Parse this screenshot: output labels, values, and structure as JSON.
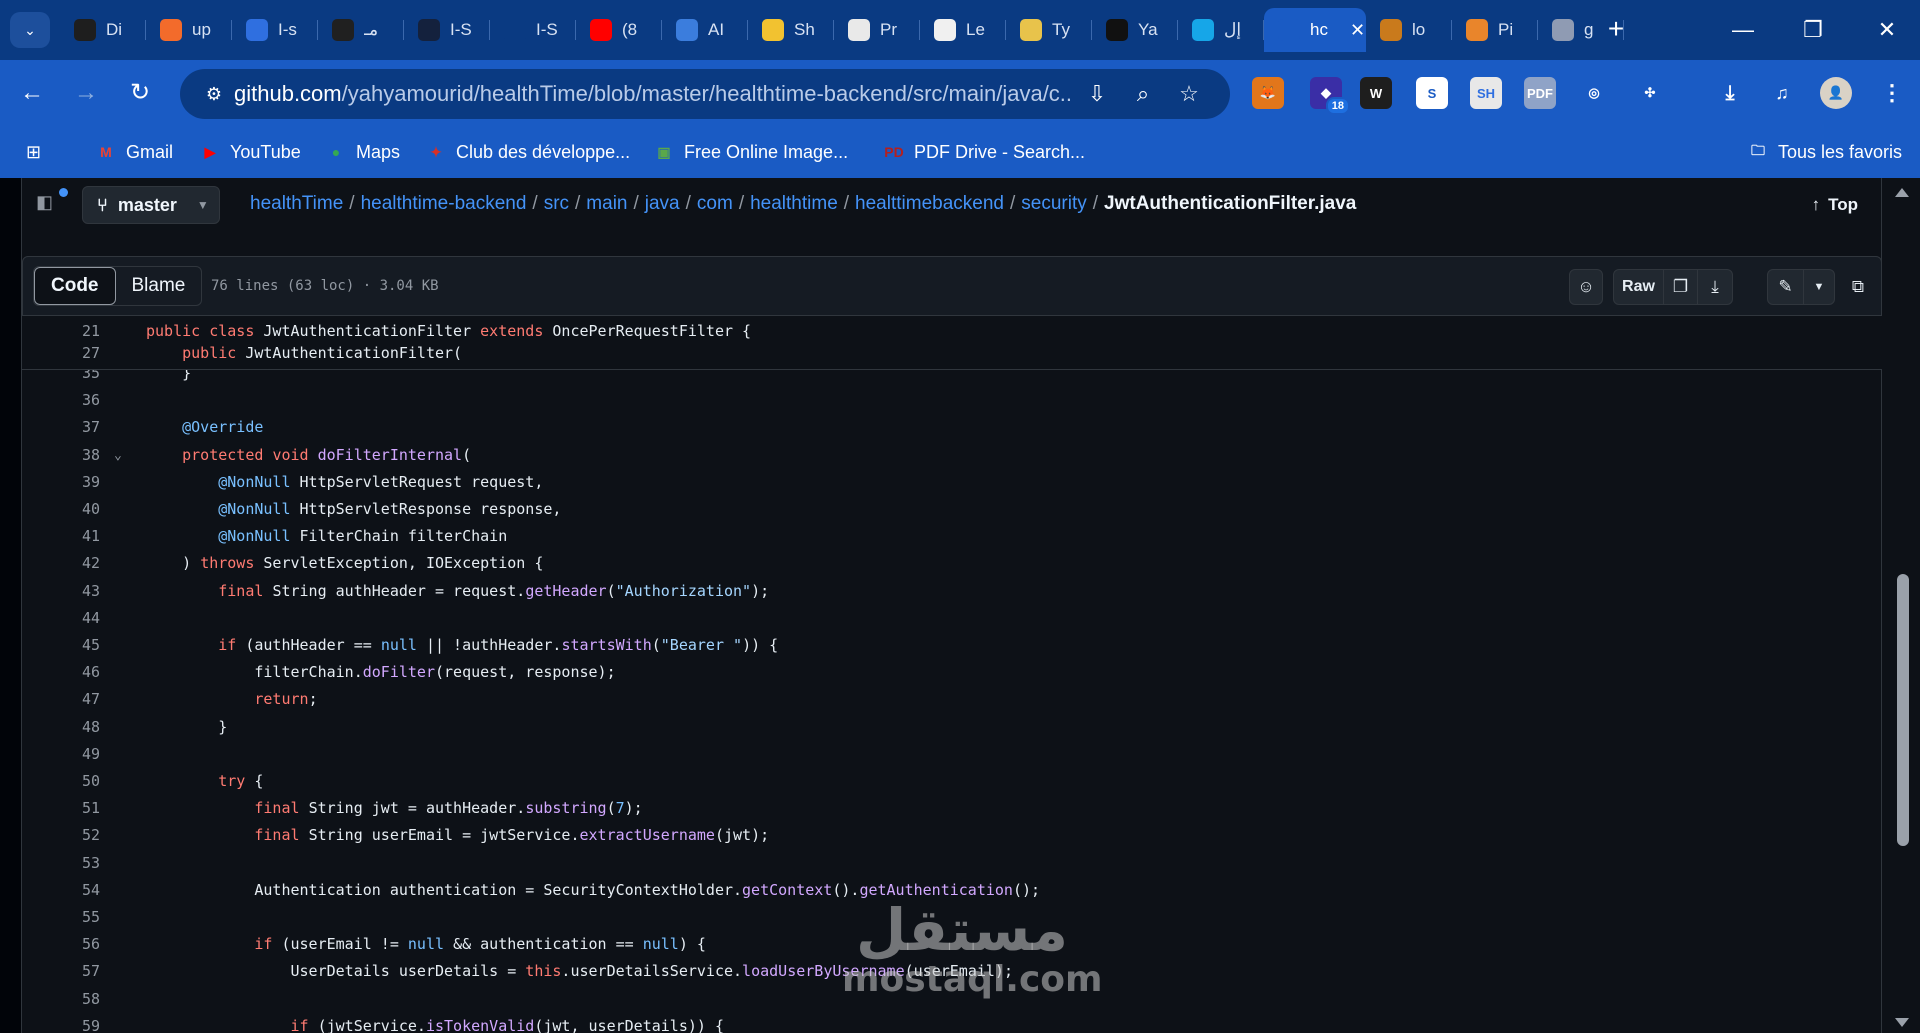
{
  "browser": {
    "tabs": [
      {
        "title": "Di",
        "icon": "wakatime-icon",
        "color": "#1e1e1e"
      },
      {
        "title": "up",
        "icon": "compass-icon",
        "color": "#f36b2b"
      },
      {
        "title": "I-s",
        "icon": "ide-icon",
        "color": "#2f6fe0"
      },
      {
        "title": "مـ",
        "icon": "openai-icon",
        "color": "#202020"
      },
      {
        "title": "I-S",
        "icon": "keyhole-icon",
        "color": "#14213d"
      },
      {
        "title": "I-S",
        "icon": "play-icon",
        "color": "#0a3a82"
      },
      {
        "title": "(8",
        "icon": "youtube-icon",
        "color": "#ff0000"
      },
      {
        "title": "AI",
        "icon": "iq-icon",
        "color": "#3b7ddd"
      },
      {
        "title": "Sh",
        "icon": "shield-icon",
        "color": "#f2c230"
      },
      {
        "title": "Pr",
        "icon": "document-icon",
        "color": "#e9e9e9"
      },
      {
        "title": "Le",
        "icon": "avatar-icon",
        "color": "#f0f0f0"
      },
      {
        "title": "Ty",
        "icon": "lock-icon",
        "color": "#e8c34b"
      },
      {
        "title": "Ya",
        "icon": "upwork-icon",
        "color": "#111111"
      },
      {
        "title": "إل",
        "icon": "circle-icon",
        "color": "#16a6e8"
      },
      {
        "title": "hc",
        "icon": "github-icon",
        "color": "#1a5bc4",
        "active": true
      },
      {
        "title": "lo",
        "icon": "mountain-icon",
        "color": "#c97a1c"
      },
      {
        "title": "Pi",
        "icon": "brush-icon",
        "color": "#e9852b"
      },
      {
        "title": "g",
        "icon": "globe-icon",
        "color": "#8f9bb3"
      }
    ],
    "active_close": "✕",
    "new_tab": "+",
    "url_host": "github.com",
    "url_path": "/yahyamourid/healthTime/blob/master/healthtime-backend/src/main/java/c...",
    "extension_badge": "18",
    "bookmarks": [
      {
        "label": "Gmail",
        "icon": "gmail-icon",
        "glyph": "M",
        "color": "#ea4335"
      },
      {
        "label": "YouTube",
        "icon": "youtube-icon",
        "glyph": "▶",
        "color": "#ff0000"
      },
      {
        "label": "Maps",
        "icon": "maps-pin-icon",
        "glyph": "●",
        "color": "#34a853"
      },
      {
        "label": "Club des développe...",
        "icon": "developpez-icon",
        "glyph": "✦",
        "color": "#d93025"
      },
      {
        "label": "Free Online Image...",
        "icon": "image-icon",
        "glyph": "▣",
        "color": "#5aa84a"
      },
      {
        "label": "PDF Drive - Search...",
        "icon": "pdf-drive-icon",
        "glyph": "PD",
        "color": "#b32020"
      }
    ],
    "all_bookmarks": "Tous les favoris"
  },
  "github": {
    "branch": "master",
    "breadcrumb": [
      "healthTime",
      "healthtime-backend",
      "src",
      "main",
      "java",
      "com",
      "healthtime",
      "healttimebackend",
      "security"
    ],
    "filename": "JwtAuthenticationFilter.java",
    "top_label": "Top",
    "tabs": {
      "code": "Code",
      "blame": "Blame"
    },
    "file_meta": "76 lines (63 loc) · 3.04 KB",
    "raw_label": "Raw"
  },
  "sticky_lines": [
    {
      "n": "21",
      "tokens": [
        [
          "k",
          "public "
        ],
        [
          "k",
          "class "
        ],
        [
          "t",
          "JwtAuthenticationFilter "
        ],
        [
          "k",
          "extends "
        ],
        [
          "t",
          "OncePerRequestFilter {"
        ]
      ]
    },
    {
      "n": "27",
      "tokens": [
        [
          "t",
          "    "
        ],
        [
          "k",
          "public "
        ],
        [
          "t",
          "JwtAuthenticationFilter("
        ]
      ]
    }
  ],
  "code_lines": [
    {
      "n": "35",
      "tokens": [
        [
          "t",
          "    }"
        ]
      ],
      "partial": true
    },
    {
      "n": "36",
      "tokens": []
    },
    {
      "n": "37",
      "tokens": [
        [
          "t",
          "    "
        ],
        [
          "m",
          "@Override"
        ]
      ]
    },
    {
      "n": "38",
      "fold": true,
      "tokens": [
        [
          "t",
          "    "
        ],
        [
          "k",
          "protected "
        ],
        [
          "k",
          "void "
        ],
        [
          "f",
          "doFilterInternal"
        ],
        [
          "t",
          "("
        ]
      ]
    },
    {
      "n": "39",
      "tokens": [
        [
          "t",
          "        "
        ],
        [
          "m",
          "@NonNull "
        ],
        [
          "t",
          "HttpServletRequest request,"
        ]
      ]
    },
    {
      "n": "40",
      "tokens": [
        [
          "t",
          "        "
        ],
        [
          "m",
          "@NonNull "
        ],
        [
          "t",
          "HttpServletResponse response,"
        ]
      ]
    },
    {
      "n": "41",
      "tokens": [
        [
          "t",
          "        "
        ],
        [
          "m",
          "@NonNull "
        ],
        [
          "t",
          "FilterChain filterChain"
        ]
      ]
    },
    {
      "n": "42",
      "tokens": [
        [
          "t",
          "    ) "
        ],
        [
          "k",
          "throws "
        ],
        [
          "t",
          "ServletException, IOException {"
        ]
      ]
    },
    {
      "n": "43",
      "tokens": [
        [
          "t",
          "        "
        ],
        [
          "k",
          "final "
        ],
        [
          "t",
          "String authHeader = request."
        ],
        [
          "f",
          "getHeader"
        ],
        [
          "t",
          "("
        ],
        [
          "s",
          "\"Authorization\""
        ],
        [
          "t",
          ");"
        ]
      ]
    },
    {
      "n": "44",
      "tokens": []
    },
    {
      "n": "45",
      "tokens": [
        [
          "t",
          "        "
        ],
        [
          "k",
          "if "
        ],
        [
          "t",
          "(authHeader == "
        ],
        [
          "m",
          "null "
        ],
        [
          "t",
          "|| !authHeader."
        ],
        [
          "f",
          "startsWith"
        ],
        [
          "t",
          "("
        ],
        [
          "s",
          "\"Bearer \""
        ],
        [
          "t",
          ")) {"
        ]
      ]
    },
    {
      "n": "46",
      "tokens": [
        [
          "t",
          "            filterChain."
        ],
        [
          "f",
          "doFilter"
        ],
        [
          "t",
          "(request, response);"
        ]
      ]
    },
    {
      "n": "47",
      "tokens": [
        [
          "t",
          "            "
        ],
        [
          "k",
          "return"
        ],
        [
          "t",
          ";"
        ]
      ]
    },
    {
      "n": "48",
      "tokens": [
        [
          "t",
          "        }"
        ]
      ]
    },
    {
      "n": "49",
      "tokens": []
    },
    {
      "n": "50",
      "tokens": [
        [
          "t",
          "        "
        ],
        [
          "k",
          "try "
        ],
        [
          "t",
          "{"
        ]
      ]
    },
    {
      "n": "51",
      "tokens": [
        [
          "t",
          "            "
        ],
        [
          "k",
          "final "
        ],
        [
          "t",
          "String jwt = authHeader."
        ],
        [
          "f",
          "substring"
        ],
        [
          "t",
          "("
        ],
        [
          "m",
          "7"
        ],
        [
          "t",
          ");"
        ]
      ]
    },
    {
      "n": "52",
      "tokens": [
        [
          "t",
          "            "
        ],
        [
          "k",
          "final "
        ],
        [
          "t",
          "String userEmail = jwtService."
        ],
        [
          "f",
          "extractUsername"
        ],
        [
          "t",
          "(jwt);"
        ]
      ]
    },
    {
      "n": "53",
      "tokens": []
    },
    {
      "n": "54",
      "tokens": [
        [
          "t",
          "            Authentication authentication = SecurityContextHolder."
        ],
        [
          "f",
          "getContext"
        ],
        [
          "t",
          "()."
        ],
        [
          "f",
          "getAuthentication"
        ],
        [
          "t",
          "();"
        ]
      ]
    },
    {
      "n": "55",
      "tokens": []
    },
    {
      "n": "56",
      "tokens": [
        [
          "t",
          "            "
        ],
        [
          "k",
          "if "
        ],
        [
          "t",
          "(userEmail != "
        ],
        [
          "m",
          "null "
        ],
        [
          "t",
          "&& authentication == "
        ],
        [
          "m",
          "null"
        ],
        [
          "t",
          ") {"
        ]
      ]
    },
    {
      "n": "57",
      "tokens": [
        [
          "t",
          "                UserDetails userDetails = "
        ],
        [
          "k",
          "this"
        ],
        [
          "t",
          ".userDetailsService."
        ],
        [
          "f",
          "loadUserByUsername"
        ],
        [
          "t",
          "(userEmail);"
        ]
      ]
    },
    {
      "n": "58",
      "tokens": []
    },
    {
      "n": "59",
      "tokens": [
        [
          "t",
          "                "
        ],
        [
          "k",
          "if "
        ],
        [
          "t",
          "(jwtService."
        ],
        [
          "f",
          "isTokenValid"
        ],
        [
          "t",
          "(jwt, userDetails)) {"
        ]
      ]
    }
  ],
  "watermark": {
    "arabic": "مستقل",
    "latin": "mostaql.com"
  }
}
